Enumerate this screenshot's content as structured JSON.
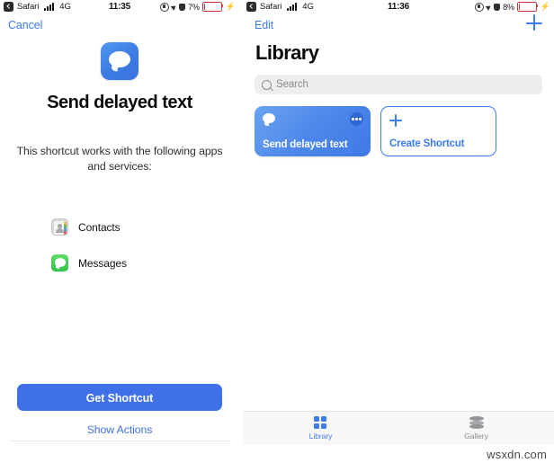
{
  "left_panel": {
    "status_bar": {
      "back_app": "Safari",
      "network": "4G",
      "time": "11:35",
      "battery_percent": "7%",
      "battery_level": 7,
      "lock_icon": "rotation-lock-icon",
      "location_icon": "location-arrow-icon",
      "shield_icon": "vpn-shield-icon",
      "charging_icon": "lightning-bolt-icon"
    },
    "nav": {
      "cancel_label": "Cancel"
    },
    "hero": {
      "icon": "message-bubble-icon",
      "title": "Send delayed text",
      "subtitle": "This shortcut works with the following apps and services:"
    },
    "apps": [
      {
        "name": "Contacts",
        "icon": "contacts-app-icon"
      },
      {
        "name": "Messages",
        "icon": "messages-app-icon"
      }
    ],
    "actions": {
      "primary_label": "Get Shortcut",
      "link_label": "Show Actions"
    }
  },
  "right_panel": {
    "status_bar": {
      "back_app": "Safari",
      "network": "4G",
      "time": "11:36",
      "battery_percent": "8%",
      "battery_level": 8,
      "lock_icon": "rotation-lock-icon",
      "location_icon": "location-arrow-icon",
      "shield_icon": "vpn-shield-icon",
      "charging_icon": "lightning-bolt-icon"
    },
    "nav": {
      "edit_label": "Edit",
      "add_icon": "plus-icon"
    },
    "title": "Library",
    "search": {
      "placeholder": "Search",
      "icon": "search-icon"
    },
    "cards": [
      {
        "label": "Send delayed text",
        "icon": "message-bubble-icon",
        "menu_icon": "ellipsis-icon",
        "type": "shortcut"
      },
      {
        "label": "Create Shortcut",
        "icon": "plus-icon",
        "type": "create"
      }
    ],
    "tabs": [
      {
        "label": "Library",
        "icon": "grid-icon",
        "active": true
      },
      {
        "label": "Gallery",
        "icon": "layers-icon",
        "active": false
      }
    ]
  },
  "watermark": "wsxdn.com",
  "colors": {
    "accent_blue": "#3d7cf0",
    "button_blue": "#4070e8",
    "card_blue": "#4b86ea",
    "messages_green": "#2fc44a",
    "battery_red": "#c9353a",
    "inactive_grey": "#8e8e93",
    "search_bg": "#eeeeef",
    "tabbar_bg": "#f7f7f8"
  }
}
